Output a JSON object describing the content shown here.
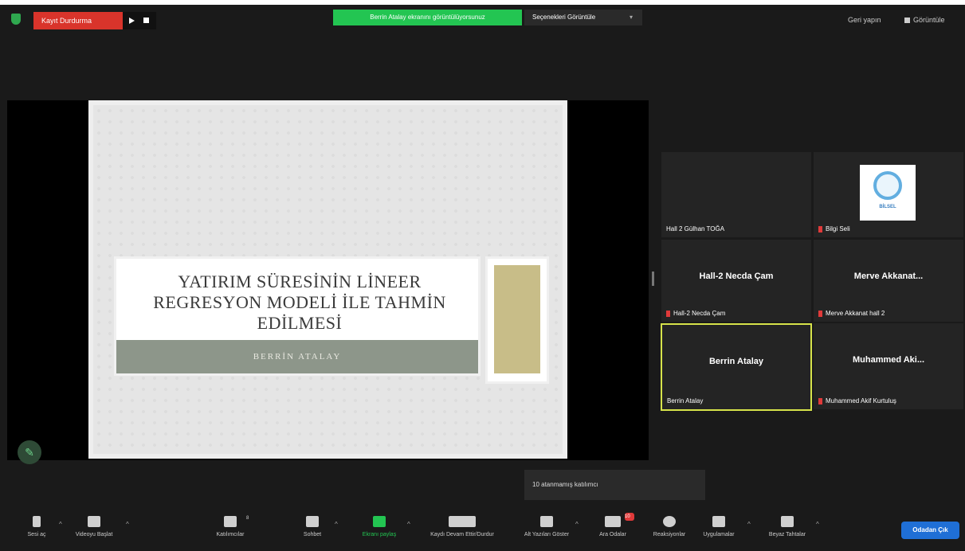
{
  "top_bar": {
    "recording_label": "Kayıt Durdurma",
    "share_banner": "Berrin Atalay ekranını görüntülüyorsunuz",
    "view_options": "Seçenekleri Görüntüle",
    "exit_fullscreen": "Geri yapın",
    "view": "Görüntüle"
  },
  "slide": {
    "title": "YATIRIM SÜRESİNİN LİNEER REGRESYON MODELİ İLE TAHMİN EDİLMESİ",
    "author": "BERRİN ATALAY"
  },
  "gallery": {
    "tiles": [
      {
        "label": "Hall 2 Gülhan TOĞA",
        "name": "",
        "muted": false
      },
      {
        "label": "Bilgi Seli",
        "name": "",
        "muted": true,
        "logo_text": "BİLSEL"
      },
      {
        "label": "Hall-2 Necda Çam",
        "name": "Hall-2 Necda Çam",
        "muted": true
      },
      {
        "label": "Merve Akkanat hall 2",
        "name": "Merve Akkanat...",
        "muted": true
      },
      {
        "label": "Berrin Atalay",
        "name": "Berrin Atalay",
        "muted": false
      },
      {
        "label": "Muhammed Akif Kurtuluş",
        "name": "Muhammed Aki...",
        "muted": true
      }
    ]
  },
  "tooltip": "10 atanmamış katılımcı",
  "toolbar": {
    "audio": "Sesi aç",
    "video": "Videoyu Başlat",
    "participants": "Katılımcılar",
    "participants_count": "8",
    "chat": "Sohbet",
    "share": "Ekranı paylaş",
    "record": "Kaydı Devam Ettir/Durdur",
    "captions": "Alt Yazıları Göster",
    "breakout": "Ara Odalar",
    "breakout_badge": "10",
    "reactions": "Reaksiyonlar",
    "apps": "Uygulamalar",
    "whiteboards": "Beyaz Tahtalar",
    "leave": "Odadan Çık"
  },
  "colors": {
    "recording": "#d9342b",
    "share_green": "#23c552",
    "active_speaker": "#d6e34a",
    "leave_blue": "#1f6fd6"
  }
}
